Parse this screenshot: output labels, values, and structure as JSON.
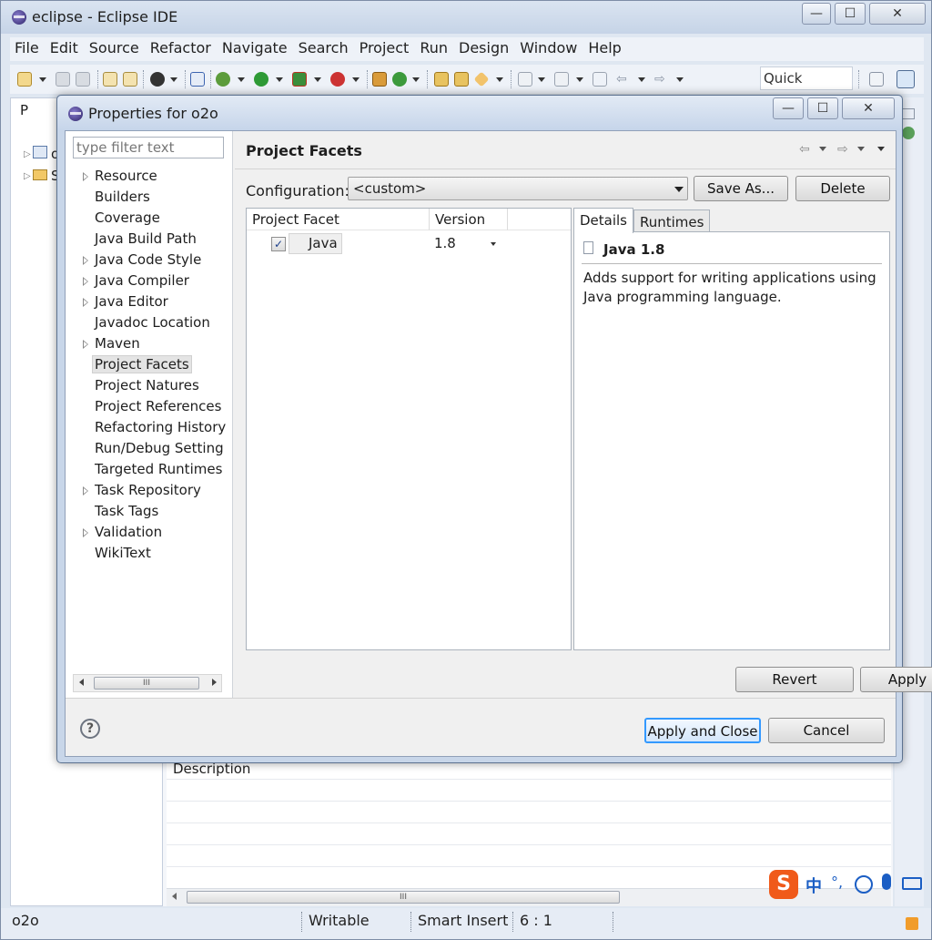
{
  "window": {
    "title": "eclipse - Eclipse IDE",
    "controls": {
      "minimize": "—",
      "maximize": "☐",
      "close": "✕"
    }
  },
  "menu": [
    "File",
    "Edit",
    "Source",
    "Refactor",
    "Navigate",
    "Search",
    "Project",
    "Run",
    "Design",
    "Window",
    "Help"
  ],
  "toolbar": {
    "quick_access": "Quick Access",
    "icons": [
      "new-icon",
      "save-icon",
      "save-all-icon",
      "history-icon",
      "refresh-icon",
      "profile-icon",
      "skip-breakpoints-icon",
      "debug-icon",
      "run-icon",
      "coverage-icon",
      "external-tools-icon",
      "new-java-package-icon",
      "new-java-class-icon",
      "open-type-icon",
      "open-folder-icon",
      "open-task-icon",
      "search-icon",
      "next-annotation-icon",
      "prev-annotation-icon",
      "last-edit-icon",
      "back-icon",
      "forward-icon",
      "open-perspective-icon",
      "java-perspective-icon"
    ]
  },
  "background": {
    "explorer_tab_label": "P",
    "explorer_items": [
      "o",
      "S"
    ],
    "description_header": "Description"
  },
  "status": {
    "project": "o2o",
    "mode": "Writable",
    "insert": "Smart Insert",
    "position": "6 : 1"
  },
  "ime": {
    "label": "中"
  },
  "dialog": {
    "title": "Properties for o2o",
    "filter_placeholder": "type filter text",
    "tree": [
      {
        "label": "Resource",
        "expandable": true
      },
      {
        "label": "Builders",
        "expandable": false
      },
      {
        "label": "Coverage",
        "expandable": false
      },
      {
        "label": "Java Build Path",
        "expandable": false
      },
      {
        "label": "Java Code Style",
        "expandable": true
      },
      {
        "label": "Java Compiler",
        "expandable": true
      },
      {
        "label": "Java Editor",
        "expandable": true
      },
      {
        "label": "Javadoc Location",
        "expandable": false
      },
      {
        "label": "Maven",
        "expandable": true
      },
      {
        "label": "Project Facets",
        "expandable": false,
        "selected": true
      },
      {
        "label": "Project Natures",
        "expandable": false
      },
      {
        "label": "Project References",
        "expandable": false
      },
      {
        "label": "Refactoring History",
        "expandable": false
      },
      {
        "label": "Run/Debug Setting",
        "expandable": false
      },
      {
        "label": "Targeted Runtimes",
        "expandable": false
      },
      {
        "label": "Task Repository",
        "expandable": true
      },
      {
        "label": "Task Tags",
        "expandable": false
      },
      {
        "label": "Validation",
        "expandable": true
      },
      {
        "label": "WikiText",
        "expandable": false
      }
    ],
    "page": {
      "title": "Project Facets",
      "configuration_label": "Configuration:",
      "configuration_value": "<custom>",
      "save_as": "Save As...",
      "delete": "Delete",
      "columns": [
        "Project Facet",
        "Version"
      ],
      "facet": {
        "name": "Java",
        "version": "1.8",
        "checked": true
      },
      "tabs": [
        "Details",
        "Runtimes"
      ],
      "details_heading": "Java 1.8",
      "details_text": "Adds support for writing applications using Java programming language.",
      "revert": "Revert",
      "apply": "Apply"
    },
    "apply_and_close": "Apply and Close",
    "cancel": "Cancel",
    "help": "?"
  },
  "colors": {
    "accent": "#3399ff",
    "titlebar": "#c6d4e7",
    "dialog_body": "#f0f0f0"
  }
}
